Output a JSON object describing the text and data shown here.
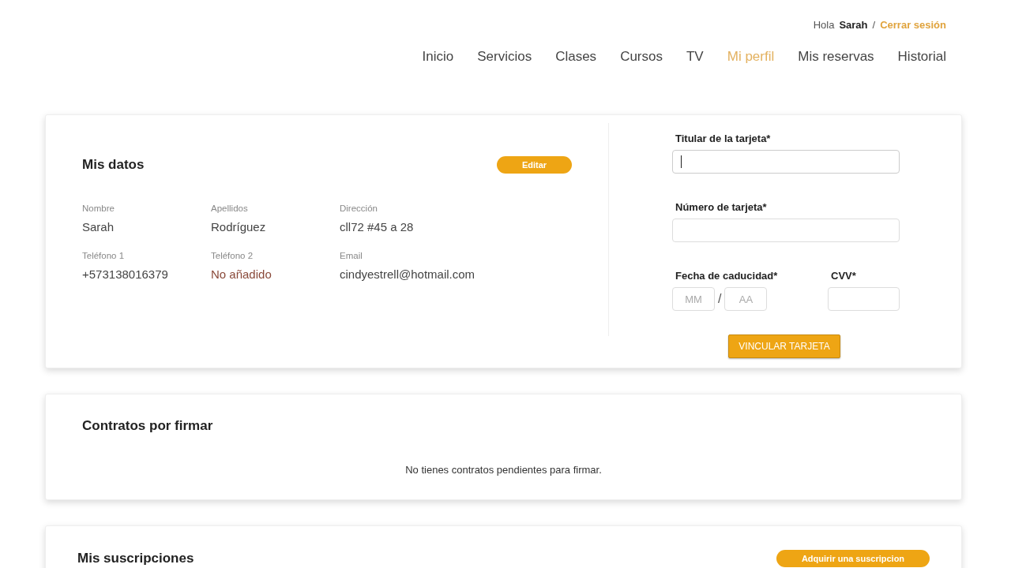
{
  "header": {
    "greeting": "Hola",
    "user": "Sarah",
    "separator": "/",
    "logout": "Cerrar sesión"
  },
  "nav": [
    {
      "label": "Inicio",
      "selected": false
    },
    {
      "label": "Servicios",
      "selected": false
    },
    {
      "label": "Clases",
      "selected": false
    },
    {
      "label": "Cursos",
      "selected": false
    },
    {
      "label": "TV",
      "selected": false
    },
    {
      "label": "Mi perfil",
      "selected": true
    },
    {
      "label": "Mis reservas",
      "selected": false
    },
    {
      "label": "Historial",
      "selected": false
    }
  ],
  "profile": {
    "title": "Mis datos",
    "edit_button": "Editar",
    "fields": [
      {
        "label": "Nombre",
        "value": "Sarah",
        "missing": false
      },
      {
        "label": "Apellidos",
        "value": "Rodríguez",
        "missing": false
      },
      {
        "label": "Dirección",
        "value": "cll72 #45 a 28",
        "missing": false
      },
      {
        "label": "Teléfono 1",
        "value": "+573138016379",
        "missing": false
      },
      {
        "label": "Teléfono 2",
        "value": "No añadido",
        "missing": true
      },
      {
        "label": "Email",
        "value": "cindyestrell@hotmail.com",
        "missing": false
      }
    ]
  },
  "card_form": {
    "holder": {
      "label": "Titular de la tarjeta*",
      "focused": true
    },
    "number": {
      "label": "Número de tarjeta*",
      "focused": false
    },
    "expiry": {
      "label": "Fecha de caducidad*",
      "month_placeholder": "MM",
      "separator": "/",
      "year_placeholder": "AA"
    },
    "cvv": {
      "label": "CVV*"
    },
    "submit": "VINCULAR TARJETA"
  },
  "contracts": {
    "title": "Contratos por firmar",
    "empty_message": "No tienes contratos pendientes para firmar."
  },
  "subscriptions": {
    "title": "Mis suscripciones",
    "button": "Adquirir una suscripcion"
  }
}
